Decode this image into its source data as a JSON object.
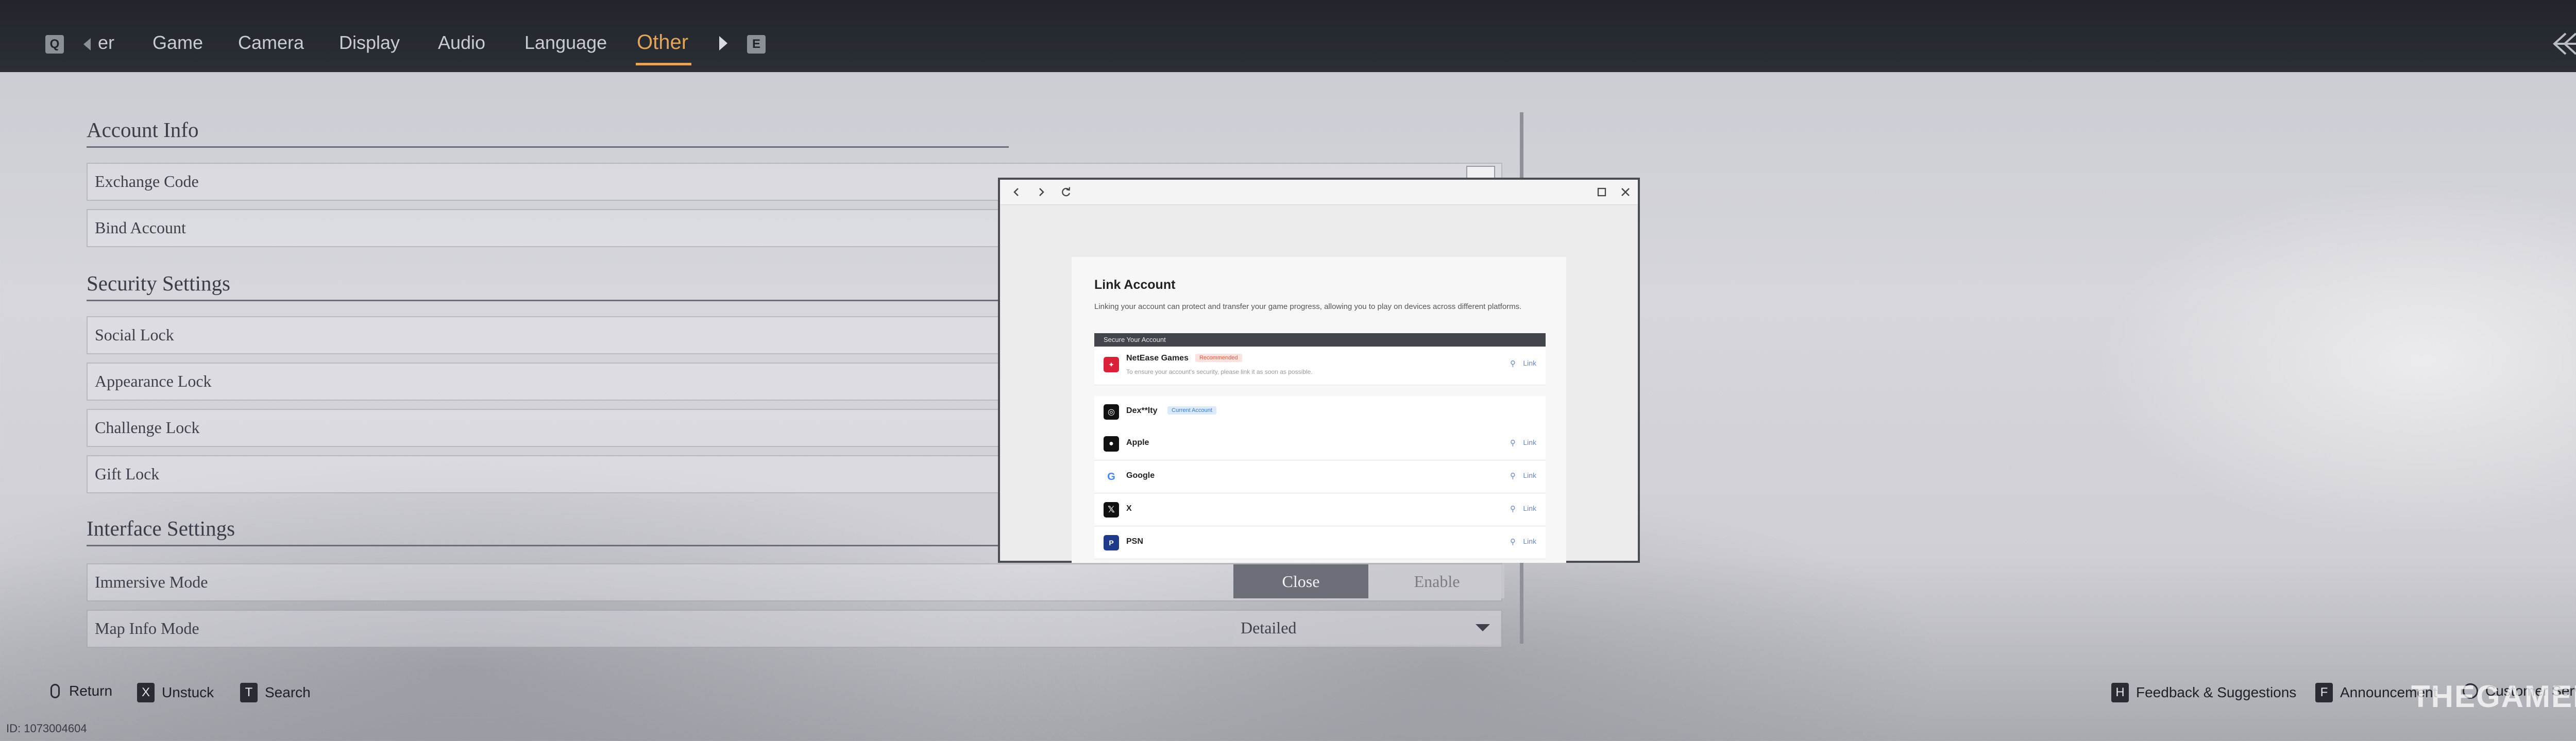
{
  "header": {
    "left_key": "Q",
    "right_key": "E",
    "tabs": [
      {
        "label": "er"
      },
      {
        "label": "Game"
      },
      {
        "label": "Camera"
      },
      {
        "label": "Display"
      },
      {
        "label": "Audio"
      },
      {
        "label": "Language"
      },
      {
        "label": "Other",
        "active": true
      }
    ],
    "accent_color": "#e2a55b"
  },
  "settings": {
    "account_info": {
      "title": "Account Info",
      "rows": [
        "Exchange Code",
        "Bind Account"
      ]
    },
    "security_settings": {
      "title": "Security Settings",
      "rows": [
        "Social Lock",
        "Appearance Lock",
        "Challenge Lock",
        "Gift Lock"
      ]
    },
    "interface_settings": {
      "title": "Interface Settings",
      "immersive_mode": {
        "label": "Immersive Mode",
        "options": [
          "Close",
          "Enable"
        ],
        "selected": "Close"
      },
      "map_info_mode": {
        "label": "Map Info Mode",
        "value": "Detailed"
      }
    }
  },
  "popup": {
    "title": "Link Account",
    "description": "Linking your account can protect and transfer your game progress, allowing you to play on devices across different platforms.",
    "section_label": "Secure Your Account",
    "netease": {
      "name": "NetEase Games",
      "badge": "Recommended",
      "note": "To ensure your account's security, please link it as soon as possible.",
      "link": "Link"
    },
    "current": {
      "name": "Dex**lty",
      "badge": "Current Account"
    },
    "accounts": [
      {
        "name": "Apple",
        "link": "Link",
        "icon": "apple-icon"
      },
      {
        "name": "Google",
        "link": "Link",
        "icon": "google-icon"
      },
      {
        "name": "X",
        "link": "Link",
        "icon": "x-icon"
      },
      {
        "name": "PSN",
        "link": "Link",
        "icon": "psn-icon"
      }
    ]
  },
  "footer": {
    "hints": [
      {
        "key": "",
        "label": "Return"
      },
      {
        "key": "X",
        "label": "Unstuck"
      },
      {
        "key": "T",
        "label": "Search"
      },
      {
        "key": "H",
        "label": "Feedback & Suggestions"
      },
      {
        "key": "F",
        "label": "Announcement"
      },
      {
        "key": "",
        "label": "Customer Service"
      }
    ],
    "uid": "ID: 1073004604",
    "watermark": "THEGAMER"
  }
}
